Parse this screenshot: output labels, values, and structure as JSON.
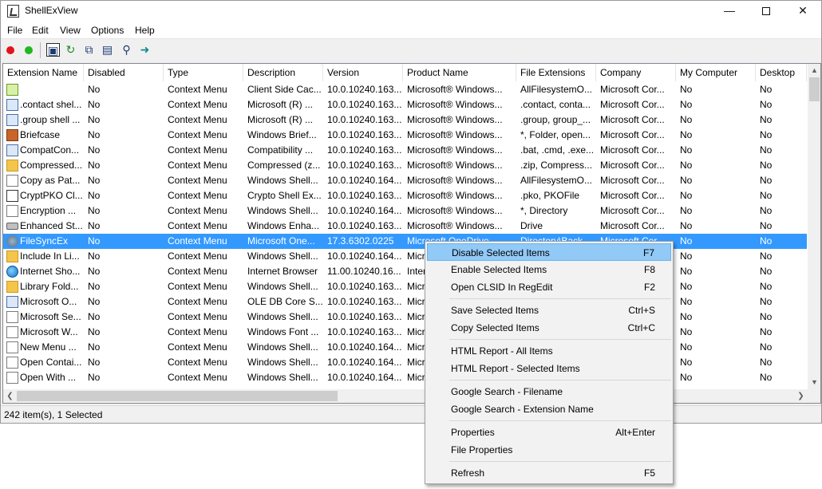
{
  "window": {
    "title": "ShellExView"
  },
  "menubar": [
    "File",
    "Edit",
    "View",
    "Options",
    "Help"
  ],
  "toolbar": {
    "buttons": [
      {
        "name": "disable-items-button",
        "icon": "red-dot-icon"
      },
      {
        "name": "enable-items-button",
        "icon": "green-dot-icon"
      },
      {
        "name": "save-button",
        "icon": "floppy-disk-icon"
      },
      {
        "name": "refresh-button",
        "icon": "refresh-icon"
      },
      {
        "name": "copy-button",
        "icon": "copy-icon"
      },
      {
        "name": "properties-button",
        "icon": "properties-icon"
      },
      {
        "name": "find-button",
        "icon": "find-icon"
      },
      {
        "name": "exit-button",
        "icon": "exit-icon"
      }
    ]
  },
  "table": {
    "columns": [
      "Extension Name",
      "Disabled",
      "Type",
      "Description",
      "Version",
      "Product Name",
      "File Extensions",
      "Company",
      "My Computer",
      "Desktop"
    ],
    "rows": [
      {
        "icon": "green",
        "cells": [
          "",
          "No",
          "Context Menu",
          "Client Side Cac...",
          "10.0.10240.163...",
          "Microsoft® Windows...",
          "AllFilesystemO...",
          "Microsoft Cor...",
          "No",
          "No"
        ]
      },
      {
        "icon": "blue",
        "cells": [
          ".contact shel...",
          "No",
          "Context Menu",
          "Microsoft (R) ...",
          "10.0.10240.163...",
          "Microsoft® Windows...",
          ".contact, conta...",
          "Microsoft Cor...",
          "No",
          "No"
        ]
      },
      {
        "icon": "blue",
        "cells": [
          ".group shell ...",
          "No",
          "Context Menu",
          "Microsoft (R) ...",
          "10.0.10240.163...",
          "Microsoft® Windows...",
          ".group, group_...",
          "Microsoft Cor...",
          "No",
          "No"
        ]
      },
      {
        "icon": "brief",
        "cells": [
          "Briefcase",
          "No",
          "Context Menu",
          "Windows Brief...",
          "10.0.10240.163...",
          "Microsoft® Windows...",
          "*, Folder, open...",
          "Microsoft Cor...",
          "No",
          "No"
        ]
      },
      {
        "icon": "blue",
        "cells": [
          "CompatCon...",
          "No",
          "Context Menu",
          "Compatibility ...",
          "10.0.10240.163...",
          "Microsoft® Windows...",
          ".bat, .cmd, .exe...",
          "Microsoft Cor...",
          "No",
          "No"
        ]
      },
      {
        "icon": "folder",
        "cells": [
          "Compressed...",
          "No",
          "Context Menu",
          "Compressed (z...",
          "10.0.10240.163...",
          "Microsoft® Windows...",
          ".zip, Compress...",
          "Microsoft Cor...",
          "No",
          "No"
        ]
      },
      {
        "icon": "doc",
        "cells": [
          "Copy as Pat...",
          "No",
          "Context Menu",
          "Windows Shell...",
          "10.0.10240.164...",
          "Microsoft® Windows...",
          "AllFilesystemO...",
          "Microsoft Cor...",
          "No",
          "No"
        ]
      },
      {
        "icon": "cert",
        "cells": [
          "CryptPKO Cl...",
          "No",
          "Context Menu",
          "Crypto Shell Ex...",
          "10.0.10240.163...",
          "Microsoft® Windows...",
          ".pko, PKOFile",
          "Microsoft Cor...",
          "No",
          "No"
        ]
      },
      {
        "icon": "doc",
        "cells": [
          "Encryption ...",
          "No",
          "Context Menu",
          "Windows Shell...",
          "10.0.10240.164...",
          "Microsoft® Windows...",
          "*, Directory",
          "Microsoft Cor...",
          "No",
          "No"
        ]
      },
      {
        "icon": "drive",
        "cells": [
          "Enhanced St...",
          "No",
          "Context Menu",
          "Windows Enha...",
          "10.0.10240.163...",
          "Microsoft® Windows...",
          "Drive",
          "Microsoft Cor...",
          "No",
          "No"
        ]
      },
      {
        "icon": "sync",
        "selected": true,
        "cells": [
          "FileSyncEx",
          "No",
          "Context Menu",
          "Microsoft One...",
          "17.3.6302.0225",
          "Microsoft OneDrive",
          "Directory\\Back...",
          "Microsoft Cor...",
          "No",
          "No"
        ]
      },
      {
        "icon": "folder",
        "cells": [
          "Include In Li...",
          "No",
          "Context Menu",
          "Windows Shell...",
          "10.0.10240.164...",
          "Micr",
          "",
          "",
          "No",
          "No"
        ]
      },
      {
        "icon": "globe",
        "cells": [
          "Internet Sho...",
          "No",
          "Context Menu",
          "Internet Browser",
          "11.00.10240.16...",
          "Inter",
          "",
          "",
          "No",
          "No"
        ]
      },
      {
        "icon": "folder",
        "cells": [
          "Library Fold...",
          "No",
          "Context Menu",
          "Windows Shell...",
          "10.0.10240.163...",
          "Micr",
          "",
          "",
          "No",
          "No"
        ]
      },
      {
        "icon": "blue",
        "cells": [
          "Microsoft O...",
          "No",
          "Context Menu",
          "OLE DB Core S...",
          "10.0.10240.163...",
          "Micr",
          "",
          "",
          "No",
          "No"
        ]
      },
      {
        "icon": "doc",
        "cells": [
          "Microsoft Se...",
          "No",
          "Context Menu",
          "Windows Shell...",
          "10.0.10240.163...",
          "Micr",
          "",
          "",
          "No",
          "No"
        ]
      },
      {
        "icon": "doc",
        "cells": [
          "Microsoft W...",
          "No",
          "Context Menu",
          "Windows Font ...",
          "10.0.10240.163...",
          "Micr",
          "",
          "",
          "No",
          "No"
        ]
      },
      {
        "icon": "doc",
        "cells": [
          "New Menu ...",
          "No",
          "Context Menu",
          "Windows Shell...",
          "10.0.10240.164...",
          "Micr",
          "",
          "",
          "No",
          "No"
        ]
      },
      {
        "icon": "doc",
        "cells": [
          "Open Contai...",
          "No",
          "Context Menu",
          "Windows Shell...",
          "10.0.10240.164...",
          "Micr",
          "",
          "",
          "No",
          "No"
        ]
      },
      {
        "icon": "doc",
        "cells": [
          "Open With ...",
          "No",
          "Context Menu",
          "Windows Shell...",
          "10.0.10240.164...",
          "Micr",
          "",
          "",
          "No",
          "No"
        ]
      }
    ]
  },
  "status": {
    "text": "242 item(s), 1 Selected"
  },
  "context_menu": {
    "groups": [
      [
        {
          "label": "Disable Selected Items",
          "shortcut": "F7",
          "highlighted": true
        },
        {
          "label": "Enable Selected Items",
          "shortcut": "F8"
        },
        {
          "label": "Open CLSID In RegEdit",
          "shortcut": "F2"
        }
      ],
      [
        {
          "label": "Save Selected Items",
          "shortcut": "Ctrl+S"
        },
        {
          "label": "Copy Selected Items",
          "shortcut": "Ctrl+C"
        }
      ],
      [
        {
          "label": "HTML Report - All Items",
          "shortcut": ""
        },
        {
          "label": "HTML Report - Selected Items",
          "shortcut": ""
        }
      ],
      [
        {
          "label": "Google Search - Filename",
          "shortcut": ""
        },
        {
          "label": "Google Search - Extension Name",
          "shortcut": ""
        }
      ],
      [
        {
          "label": "Properties",
          "shortcut": "Alt+Enter"
        },
        {
          "label": "File Properties",
          "shortcut": ""
        }
      ],
      [
        {
          "label": "Refresh",
          "shortcut": "F5"
        }
      ]
    ]
  },
  "colors": {
    "selection": "#3399ff",
    "menu_highlight": "#91c9f7"
  }
}
